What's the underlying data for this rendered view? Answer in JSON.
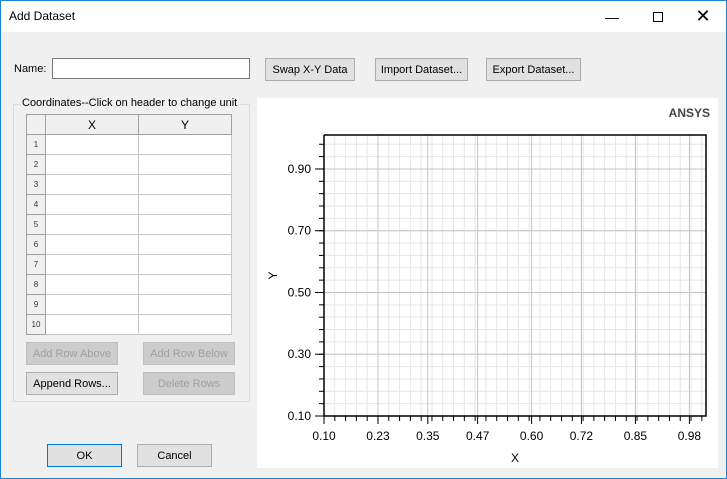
{
  "window": {
    "title": "Add Dataset"
  },
  "form": {
    "name_label": "Name:",
    "name_value": "",
    "swap_button": "Swap X-Y Data",
    "import_button": "Import Dataset...",
    "export_button": "Export Dataset..."
  },
  "coordinates": {
    "group_label": "Coordinates--Click on header to change unit",
    "columns": [
      "X",
      "Y"
    ],
    "rows": [
      "1",
      "2",
      "3",
      "4",
      "5",
      "6",
      "7",
      "8",
      "9",
      "10"
    ],
    "add_row_above": "Add Row Above",
    "add_row_below": "Add Row Below",
    "append_rows": "Append Rows...",
    "delete_rows": "Delete Rows"
  },
  "dialog": {
    "ok": "OK",
    "cancel": "Cancel"
  },
  "chart_data": {
    "type": "line",
    "brand": "ANSYS",
    "xlabel": "X",
    "ylabel": "Y",
    "xlim": [
      0.1,
      1.02
    ],
    "ylim": [
      0.1,
      1.01
    ],
    "xticks": [
      "0.10",
      "0.23",
      "0.35",
      "0.47",
      "0.60",
      "0.72",
      "0.85",
      "0.98"
    ],
    "yticks": [
      "0.10",
      "0.30",
      "0.50",
      "0.70",
      "0.90"
    ],
    "grid": true,
    "series": []
  }
}
